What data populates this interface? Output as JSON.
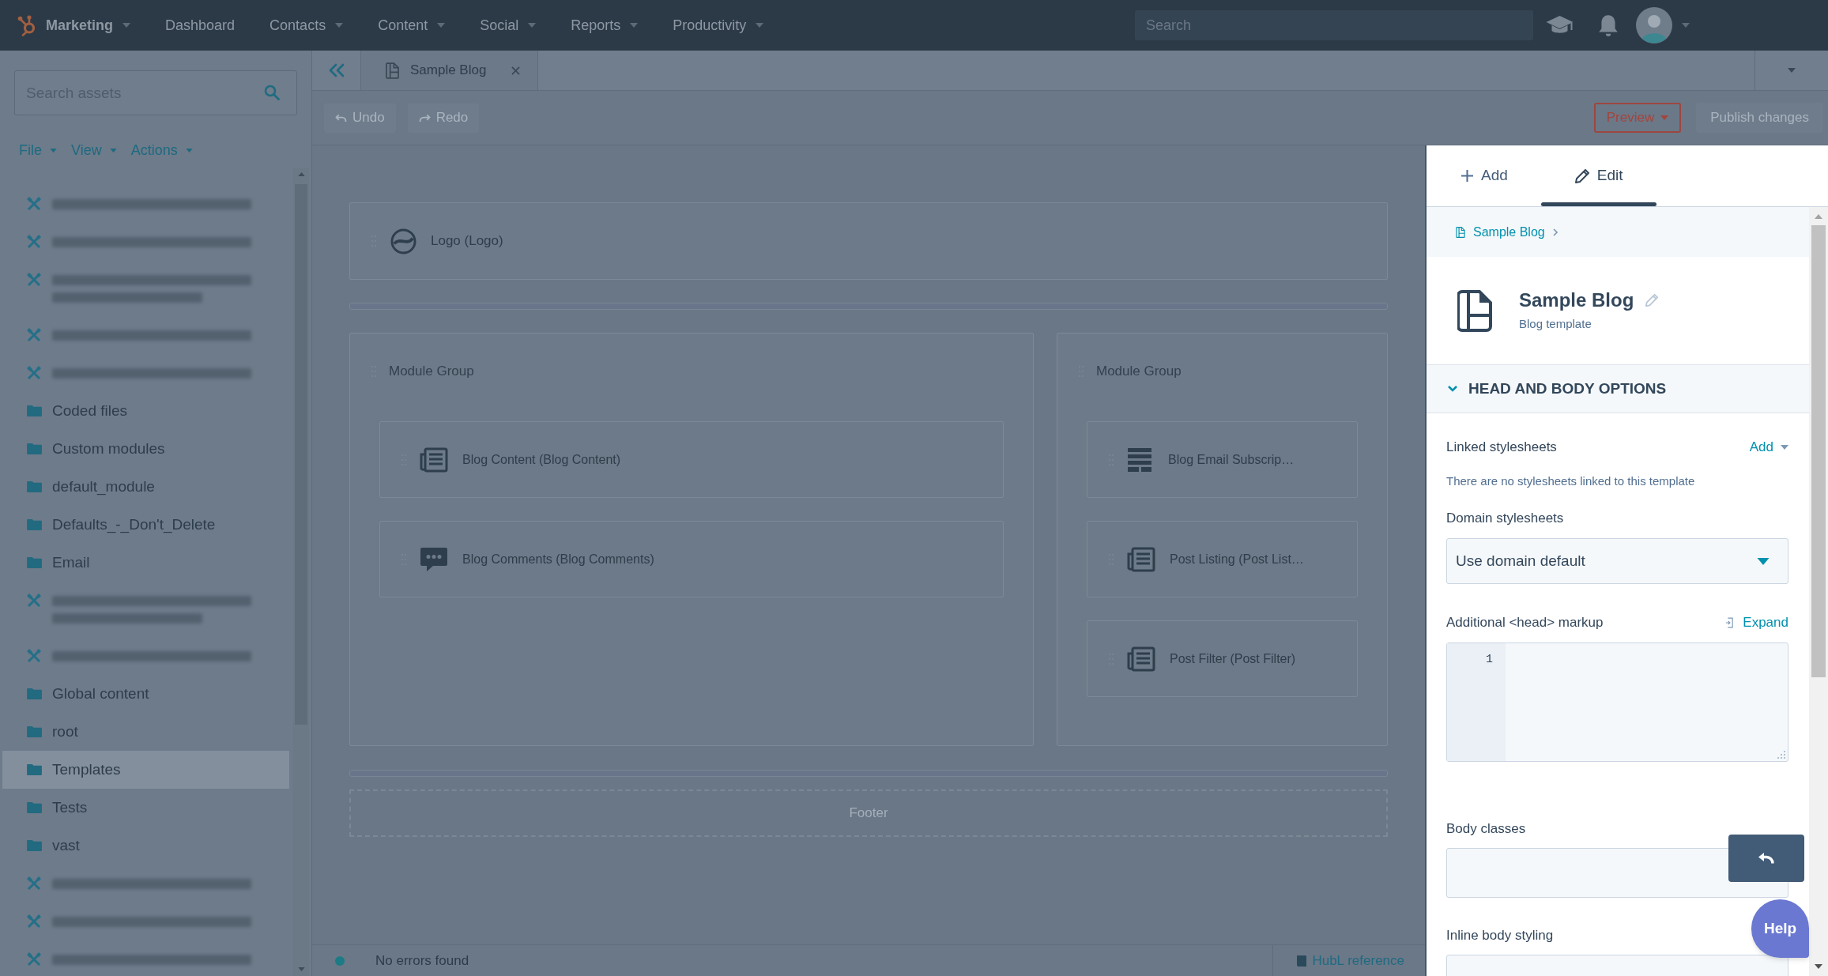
{
  "top_nav": {
    "brand": {
      "label": "Marketing",
      "has_menu": true
    },
    "items": [
      {
        "label": "Dashboard",
        "has_menu": false
      },
      {
        "label": "Contacts",
        "has_menu": true
      },
      {
        "label": "Content",
        "has_menu": true
      },
      {
        "label": "Social",
        "has_menu": true
      },
      {
        "label": "Reports",
        "has_menu": true
      },
      {
        "label": "Productivity",
        "has_menu": true
      }
    ],
    "search": {
      "placeholder": "Search"
    }
  },
  "sidebar": {
    "search": {
      "placeholder": "Search assets"
    },
    "menus": [
      "File",
      "View",
      "Actions"
    ],
    "items": [
      {
        "kind": "redacted",
        "wrapped": false,
        "selected": false
      },
      {
        "kind": "redacted",
        "wrapped": false,
        "selected": false
      },
      {
        "kind": "redacted",
        "wrapped": true,
        "selected": false
      },
      {
        "kind": "redacted",
        "wrapped": false,
        "selected": false
      },
      {
        "kind": "redacted",
        "wrapped": false,
        "selected": false
      },
      {
        "kind": "folder",
        "label": "Coded files",
        "selected": false
      },
      {
        "kind": "folder",
        "label": "Custom modules",
        "selected": false
      },
      {
        "kind": "folder",
        "label": "default_module",
        "selected": false
      },
      {
        "kind": "folder",
        "label": "Defaults_-_Don't_Delete",
        "selected": false
      },
      {
        "kind": "folder",
        "label": "Email",
        "selected": false
      },
      {
        "kind": "redacted",
        "wrapped": true,
        "selected": false
      },
      {
        "kind": "redacted",
        "wrapped": false,
        "selected": false
      },
      {
        "kind": "folder",
        "label": "Global content",
        "selected": false
      },
      {
        "kind": "folder",
        "label": "root",
        "selected": false
      },
      {
        "kind": "folder",
        "label": "Templates",
        "selected": true
      },
      {
        "kind": "folder",
        "label": "Tests",
        "selected": false
      },
      {
        "kind": "folder",
        "label": "vast",
        "selected": false
      },
      {
        "kind": "redacted",
        "wrapped": false,
        "selected": false
      },
      {
        "kind": "redacted",
        "wrapped": false,
        "selected": false
      },
      {
        "kind": "redacted",
        "wrapped": false,
        "selected": false
      }
    ]
  },
  "editor_tabs": [
    {
      "label": "Sample Blog",
      "selected": true
    }
  ],
  "toolbar": {
    "history": [
      {
        "label": "Undo",
        "disabled": true
      },
      {
        "label": "Redo",
        "disabled": true
      }
    ],
    "preview": "Preview",
    "publish": {
      "label": "Publish changes",
      "disabled": true
    }
  },
  "canvas": {
    "header_module": "Logo (Logo)",
    "groups": [
      {
        "title": "Module Group",
        "modules": [
          {
            "kind": "content",
            "label": "Blog Content (Blog Content)"
          },
          {
            "kind": "comments",
            "label": "Blog Comments (Blog Comments)"
          }
        ]
      },
      {
        "title": "Module Group",
        "modules": [
          {
            "kind": "subscribe",
            "label": "Blog Email Subscrip…"
          },
          {
            "kind": "content",
            "label": "Post Listing (Post List…"
          },
          {
            "kind": "content",
            "label": "Post Filter (Post Filter)"
          }
        ]
      }
    ],
    "footer": "Footer"
  },
  "status_bar": {
    "message": "No errors found",
    "link": "HubL reference"
  },
  "panel": {
    "tabs": [
      {
        "label": "Add",
        "selected": false
      },
      {
        "label": "Edit",
        "selected": true
      }
    ],
    "breadcrumb": "Sample Blog",
    "title": "Sample Blog",
    "subtitle": "Blog template",
    "section": {
      "title": "HEAD AND BODY OPTIONS",
      "expanded": true
    },
    "fields": [
      {
        "kind": "list",
        "label": "Linked stylesheets",
        "action": "Add",
        "empty_text": "There are no stylesheets linked to this template"
      },
      {
        "kind": "select",
        "label": "Domain stylesheets",
        "value": "Use domain default"
      },
      {
        "kind": "code",
        "label": "Additional <head> markup",
        "action": "Expand",
        "line_numbers": [
          "1"
        ]
      },
      {
        "kind": "text",
        "label": "Body classes"
      },
      {
        "kind": "text",
        "label": "Inline body styling"
      }
    ]
  },
  "help": "Help"
}
